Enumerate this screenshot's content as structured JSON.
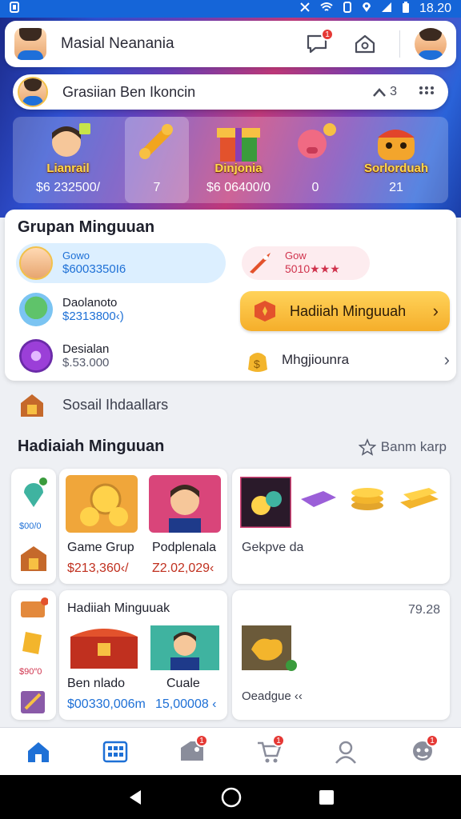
{
  "status_bar": {
    "time": "18.20"
  },
  "app_bar": {
    "title": "Masial Neanania",
    "message_badge": "1"
  },
  "profile": {
    "name": "Grasiian Ben Ikoncin",
    "score": "3"
  },
  "carousel": [
    {
      "label": "Lianrail",
      "value": "$6 232500/"
    },
    {
      "label": "",
      "value": "7"
    },
    {
      "label": "Dinjonia",
      "value": "$6 06400/0"
    },
    {
      "label": "",
      "value": "0"
    },
    {
      "label": "Sorlorduah",
      "value": "21"
    }
  ],
  "group": {
    "title": "Grupan Minguuan",
    "members": [
      {
        "name": "Gowo",
        "value": "$6003350I6"
      },
      {
        "name": "Daolanoto",
        "value": "$2313800‹)"
      },
      {
        "name": "Desialan",
        "value": "$.53.000"
      }
    ],
    "reward": {
      "name": "Gow",
      "value": "5010★★★"
    },
    "hadiah_button": "Hadiiah Minguuah",
    "secondary_item": "Mhgjiounra"
  },
  "social": {
    "label": "Sosail Ihdaallars"
  },
  "weekly": {
    "title": "Hadiaiah Minguuan",
    "see_all": "Banm karp",
    "mini_value_1": "$00/0",
    "mini_value_2": "$90″0",
    "tiles": [
      {
        "label": "Game Grup",
        "value": "$213,360‹/"
      },
      {
        "label": "Podplenala",
        "value": "Z2.02,029‹"
      },
      {
        "label": "Gekpve da",
        "value": ""
      },
      {
        "label": "Ben nlado",
        "value": "$00330,006m"
      },
      {
        "label": "Cuale",
        "value": "15,00008 ‹"
      },
      {
        "label": "Oeadgue ‹‹",
        "value": ""
      }
    ],
    "card_title": "Hadiiah Minguuak",
    "card_number": "79.28"
  },
  "bottom_nav": [
    {
      "name": "home",
      "badge": ""
    },
    {
      "name": "grid",
      "badge": ""
    },
    {
      "name": "tag",
      "badge": "1"
    },
    {
      "name": "cart",
      "badge": "1"
    },
    {
      "name": "profile",
      "badge": ""
    },
    {
      "name": "friends",
      "badge": "1"
    }
  ],
  "colors": {
    "accent": "#1565d8",
    "button": "#f5ae2a",
    "badge": "#e53935"
  }
}
